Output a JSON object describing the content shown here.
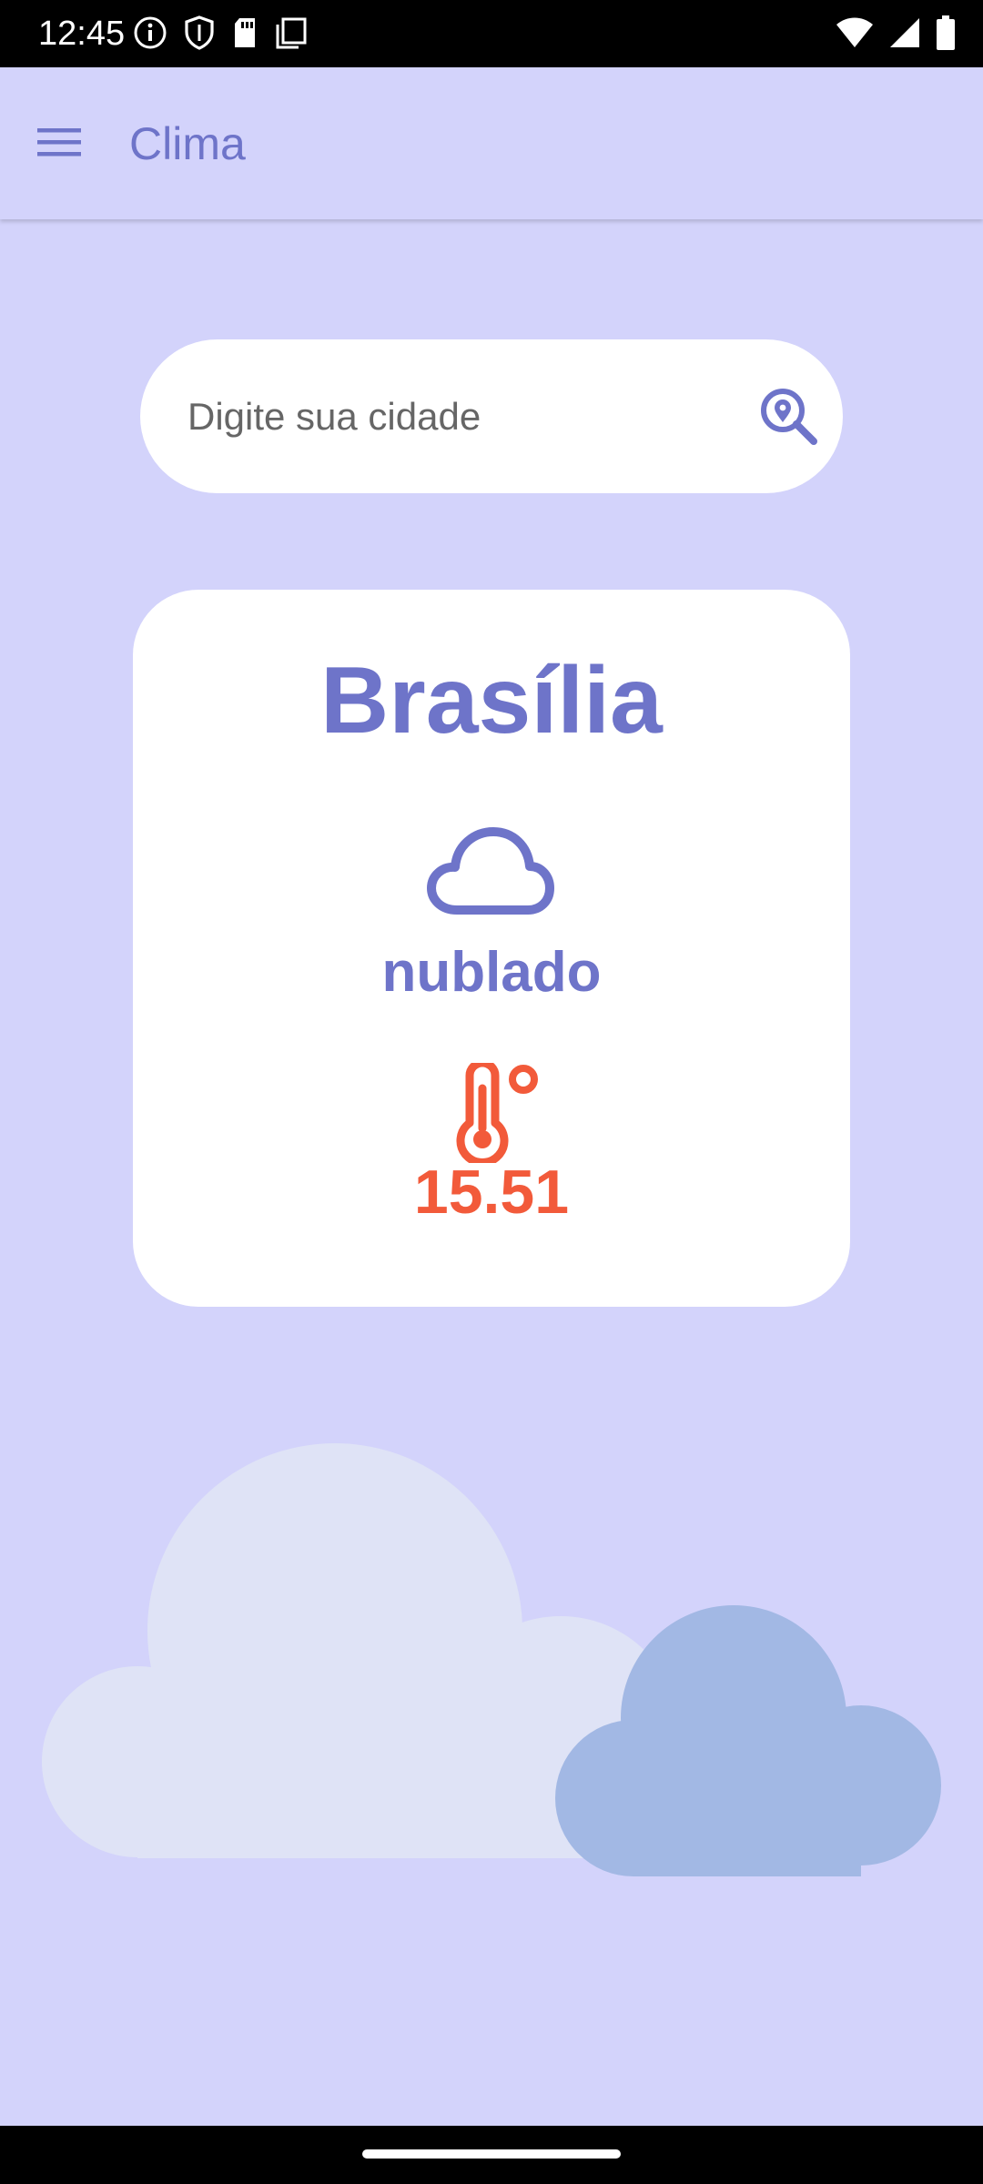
{
  "status_bar": {
    "time": "12:45",
    "left_icons": [
      "info-icon",
      "shield-icon",
      "sd-card-icon",
      "copy-icon"
    ],
    "right_icons": [
      "wifi-icon",
      "signal-icon",
      "battery-icon"
    ]
  },
  "app_bar": {
    "title": "Clima",
    "menu_icon": "hamburger-menu-icon"
  },
  "search": {
    "placeholder": "Digite sua cidade",
    "value": "",
    "button_icon": "location-search-icon"
  },
  "weather": {
    "city": "Brasília",
    "condition": "nublado",
    "condition_icon": "cloud-icon",
    "temperature": "15.51",
    "temperature_icon": "thermometer-celsius-icon"
  },
  "illustration": {
    "icon": "clouds-illustration",
    "colors": [
      "#dfe3f6",
      "#a2b8e4"
    ]
  },
  "colors": {
    "background": "#d3d3fb",
    "accent": "#6e74c9",
    "temperature": "#f25a3a",
    "card": "#ffffff"
  }
}
